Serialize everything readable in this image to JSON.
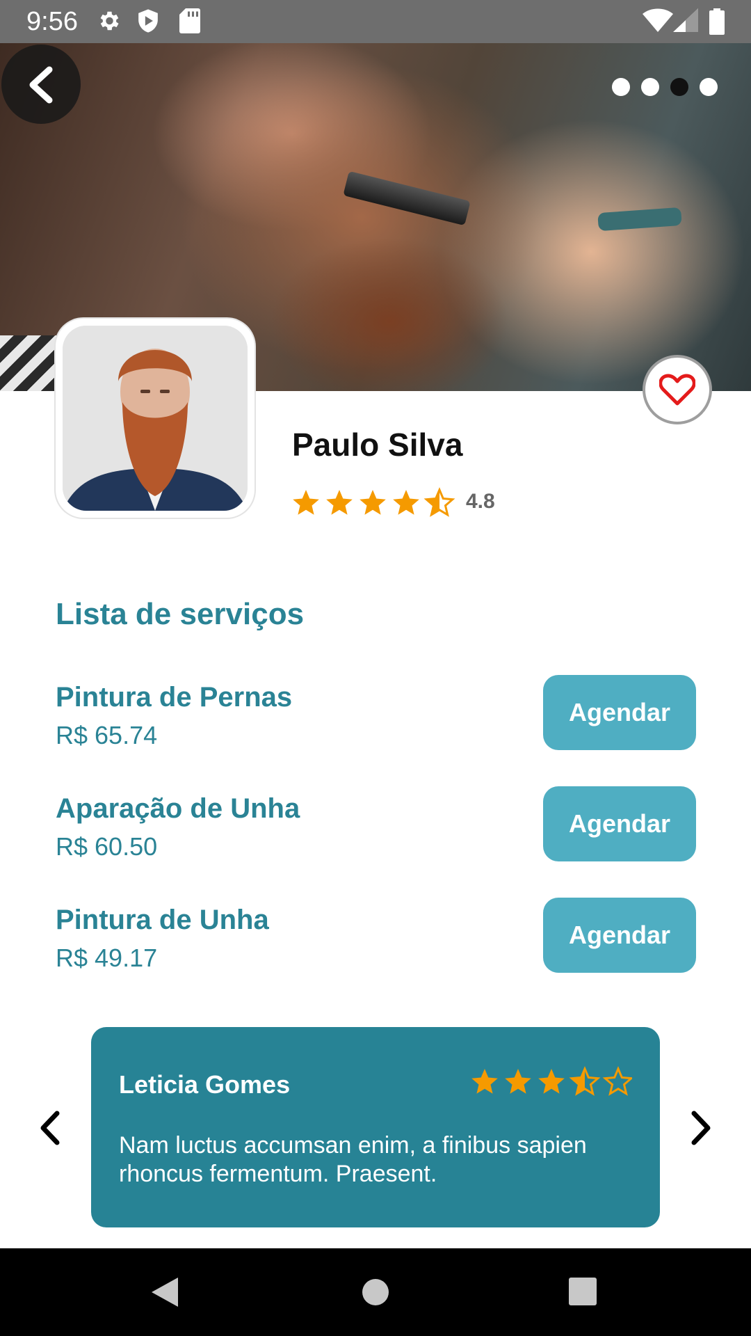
{
  "status_bar": {
    "time": "9:56",
    "left_icons": [
      "settings-icon",
      "shield-icon",
      "sd-card-icon"
    ],
    "right_icons": [
      "wifi-icon",
      "signal-icon",
      "battery-icon"
    ],
    "background": "#6e6e6e"
  },
  "hero": {
    "carousel_pages": 4,
    "active_page_index": 2
  },
  "barber": {
    "name": "Paulo Silva",
    "rating": "4.8",
    "stars": 4.5,
    "favorite": false
  },
  "services": {
    "title": "Lista de serviços",
    "items": [
      {
        "name": "Pintura de Pernas",
        "price": "R$ 65.74",
        "button": "Agendar"
      },
      {
        "name": "Aparação de Unha",
        "price": "R$ 60.50",
        "button": "Agendar"
      },
      {
        "name": "Pintura de Unha",
        "price": "R$ 49.17",
        "button": "Agendar"
      }
    ]
  },
  "review": {
    "reviewer": "Leticia Gomes",
    "stars": 3.5,
    "text": "Nam luctus accumsan enim, a finibus sapien rhoncus fermentum. Praesent."
  },
  "colors": {
    "accent": "#2a8395",
    "button": "#4faec2",
    "card": "#278395",
    "star": "#f59a00",
    "heart": "#e41b1b"
  },
  "nav_bar": {
    "buttons": [
      "back-triangle-icon",
      "home-circle-icon",
      "recents-square-icon"
    ]
  }
}
